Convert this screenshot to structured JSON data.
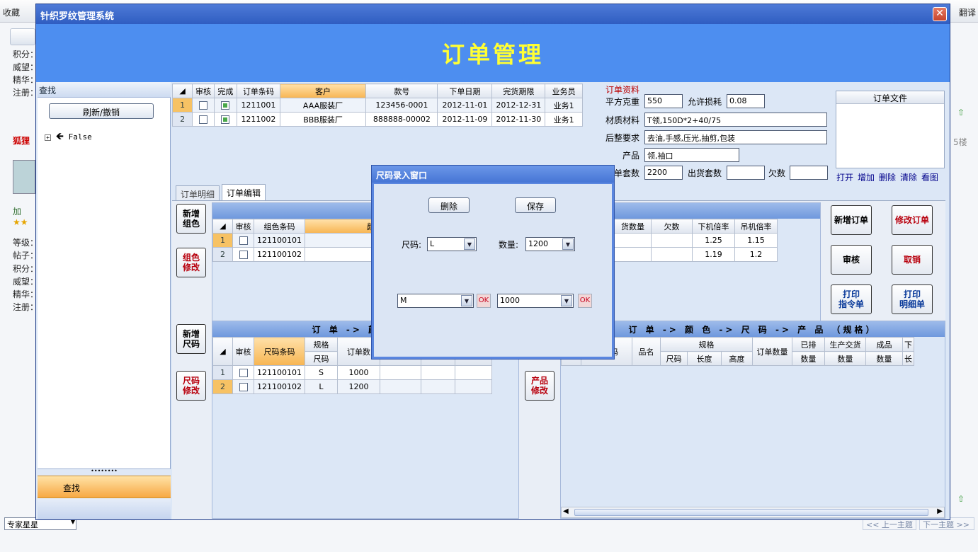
{
  "background": {
    "toolbar_left": "收藏",
    "toolbar_right": "翻译",
    "side_labels": [
      "积分：",
      "威望：",
      "精华：",
      "注册："
    ],
    "user_name": "狐狸",
    "add_label": "加",
    "side_labels2": [
      "等级：",
      "帖子：",
      "积分：",
      "威望：",
      "精华：",
      "注册："
    ],
    "floor": "5楼",
    "expert_select": "专家星星",
    "prev_topic": "<< 上一主题",
    "next_topic": "下一主题 >>"
  },
  "window": {
    "title": "针织罗纹管理系统",
    "close": "✕",
    "banner": "订单管理"
  },
  "left": {
    "header": "查找",
    "refresh_button": "刷新/撤销",
    "tree_node": "False",
    "splitter": "••••••••",
    "find_bar": "查找"
  },
  "orders_grid": {
    "columns": [
      "",
      "审核",
      "完成",
      "订单条码",
      "客户",
      "款号",
      "下单日期",
      "完货期限",
      "业务员"
    ],
    "rows": [
      {
        "rn": "1",
        "approved": false,
        "done": true,
        "code": "1211001",
        "customer": "AAA服装厂",
        "style": "123456-0001",
        "order_date": "2012-11-01",
        "deadline": "2012-12-31",
        "rep": "业务1"
      },
      {
        "rn": "2",
        "approved": false,
        "done": true,
        "code": "1211002",
        "customer": "BBB服装厂",
        "style": "888888-00002",
        "order_date": "2012-11-09",
        "deadline": "2012-11-30",
        "rep": "业务1"
      }
    ]
  },
  "order_info": {
    "section_title": "订单资料",
    "fields": {
      "sqm_weight_label": "平方克重",
      "sqm_weight": "550",
      "loss_label": "允许损耗",
      "loss": "0.08",
      "material_label": "材质材料",
      "material": "T领,150D*2+40/75",
      "finish_label": "后整要求",
      "finish": "去油,手感,压光,抽剪,包装",
      "product_label": "产品",
      "product": "领,袖口",
      "sets_label": "订单套数",
      "sets": "2200",
      "shipped_label": "出货套数",
      "shipped": "",
      "owed_label": "欠数",
      "owed": ""
    },
    "files_title": "订单文件",
    "file_links": [
      "打开",
      "增加",
      "删除",
      "清除",
      "看图"
    ]
  },
  "tabs": [
    "订单明细",
    "订单编辑"
  ],
  "color_grid": {
    "columns": [
      "",
      "审核",
      "组色条码",
      "颜"
    ],
    "rows": [
      {
        "rn": "1",
        "approved": false,
        "code": "121100101"
      },
      {
        "rn": "2",
        "approved": false,
        "code": "121100102"
      }
    ]
  },
  "color_grid_right": {
    "columns": [
      "货数量",
      "欠数",
      "下机倍率",
      "吊机倍率"
    ],
    "rows": [
      {
        "qty": "",
        "owed": "",
        "down": "1.25",
        "hang": "1.15"
      },
      {
        "qty": "",
        "owed": "",
        "down": "1.19",
        "hang": "1.2"
      }
    ]
  },
  "side_buttons": {
    "new_color": "新增\n组色",
    "edit_color": "组色\n修改",
    "new_size": "新增\n尺码",
    "edit_size": "尺码\n修改",
    "edit_product": "产品\n修改"
  },
  "action_buttons": {
    "new_order": "新增订单",
    "edit_order": "修改订单",
    "approve": "审核",
    "cancel": "取销",
    "print_cmd": "打印\n指令单",
    "print_detail": "打印\n明细单"
  },
  "size_band": "订 单 -> 颜 色 ->",
  "size_grid": {
    "columns": [
      "",
      "审核",
      "尺码条码",
      "规格",
      "订单数"
    ],
    "sub_column": "尺码",
    "rows": [
      {
        "rn": "1",
        "approved": false,
        "code": "121100101",
        "size": "S",
        "qty": "1000"
      },
      {
        "rn": "2",
        "approved": false,
        "code": "121100102",
        "size": "L",
        "qty": "1200"
      }
    ]
  },
  "product_band": "订 单 -> 颜 色 -> 尺 码 -> 产 品 （规格）",
  "product_grid": {
    "columns": [
      "品条码",
      "品名",
      "规格",
      "订单数量",
      "已排",
      "生产交货",
      "成品",
      "下"
    ],
    "sub_columns": [
      "尺码",
      "长度",
      "高度",
      "数量",
      "数量",
      "数量",
      "长"
    ]
  },
  "dialog": {
    "title": "尺码录入窗口",
    "delete_button": "删除",
    "save_button": "保存",
    "size_label": "尺码:",
    "size_value": "L",
    "qty_label": "数量:",
    "qty_value": "1200",
    "row2_size": "M",
    "row2_qty": "1000",
    "ok1": "OK",
    "ok2": "OK",
    "arrow": "▼"
  }
}
